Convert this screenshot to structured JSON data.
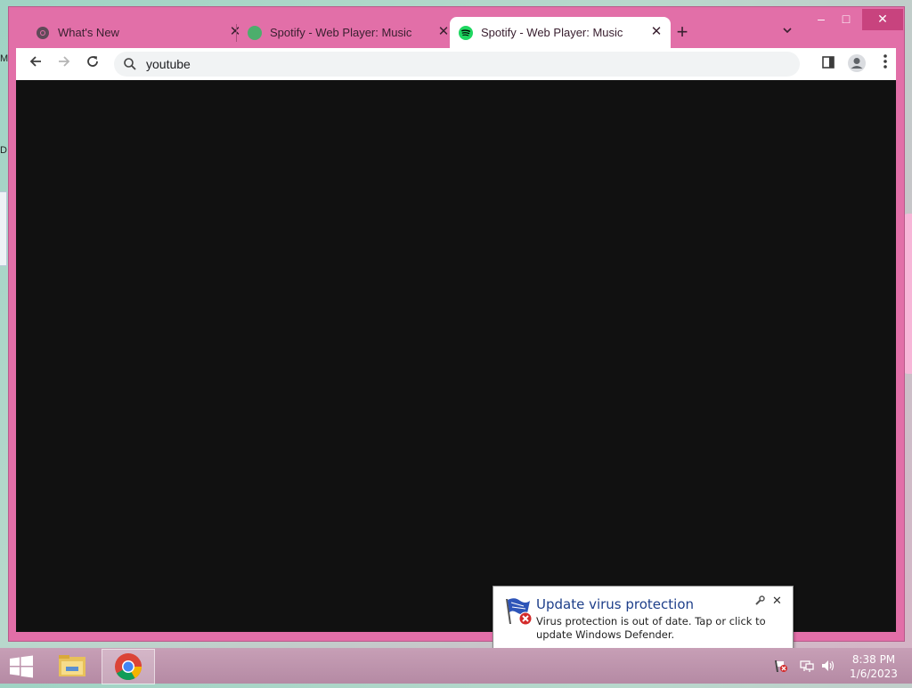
{
  "desktop": {
    "frag1": "M",
    "frag2": "D"
  },
  "browser": {
    "tabs": [
      {
        "title": "What's New"
      },
      {
        "title": "Spotify - Web Player: Music for e"
      },
      {
        "title": "Spotify - Web Player: Music for e",
        "active": true
      }
    ],
    "new_tab": "+",
    "address": "youtube",
    "window_controls": {
      "minimize": "–",
      "maximize": "□",
      "close": "✕"
    }
  },
  "notification": {
    "title": "Update virus protection",
    "body": "Virus protection is out of date. Tap or click to update Windows Defender."
  },
  "taskbar": {
    "time": "8:38 PM",
    "date": "1/6/2023",
    "apps": [
      "file-explorer",
      "google-chrome"
    ]
  },
  "colors": {
    "window_frame": "#e26fa8",
    "active_tab": "#ffffff",
    "content": "#111111",
    "spotify": "#1ed760"
  }
}
